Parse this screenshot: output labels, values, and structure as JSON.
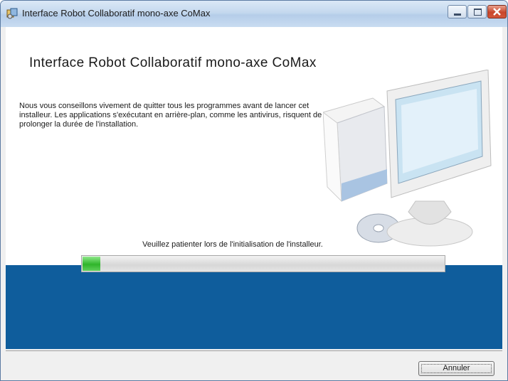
{
  "window": {
    "title": "Interface Robot Collaboratif mono-axe CoMax"
  },
  "page": {
    "heading": "Interface Robot Collaboratif mono-axe CoMax",
    "description": "Nous vous conseillons vivement de quitter tous les programmes avant de lancer cet installeur. Les applications s'exécutant en arrière-plan, comme les antivirus, risquent de prolonger la durée de l'installation.",
    "status": "Veuillez patienter lors de l'initialisation de l'installeur.",
    "progress_percent": 5
  },
  "footer": {
    "cancel_label": "Annuler"
  },
  "colors": {
    "band": "#0f5d9c",
    "progress": "#2fb52a"
  },
  "icons": {
    "app": "installer-icon",
    "illustration": "computer-illustration"
  }
}
